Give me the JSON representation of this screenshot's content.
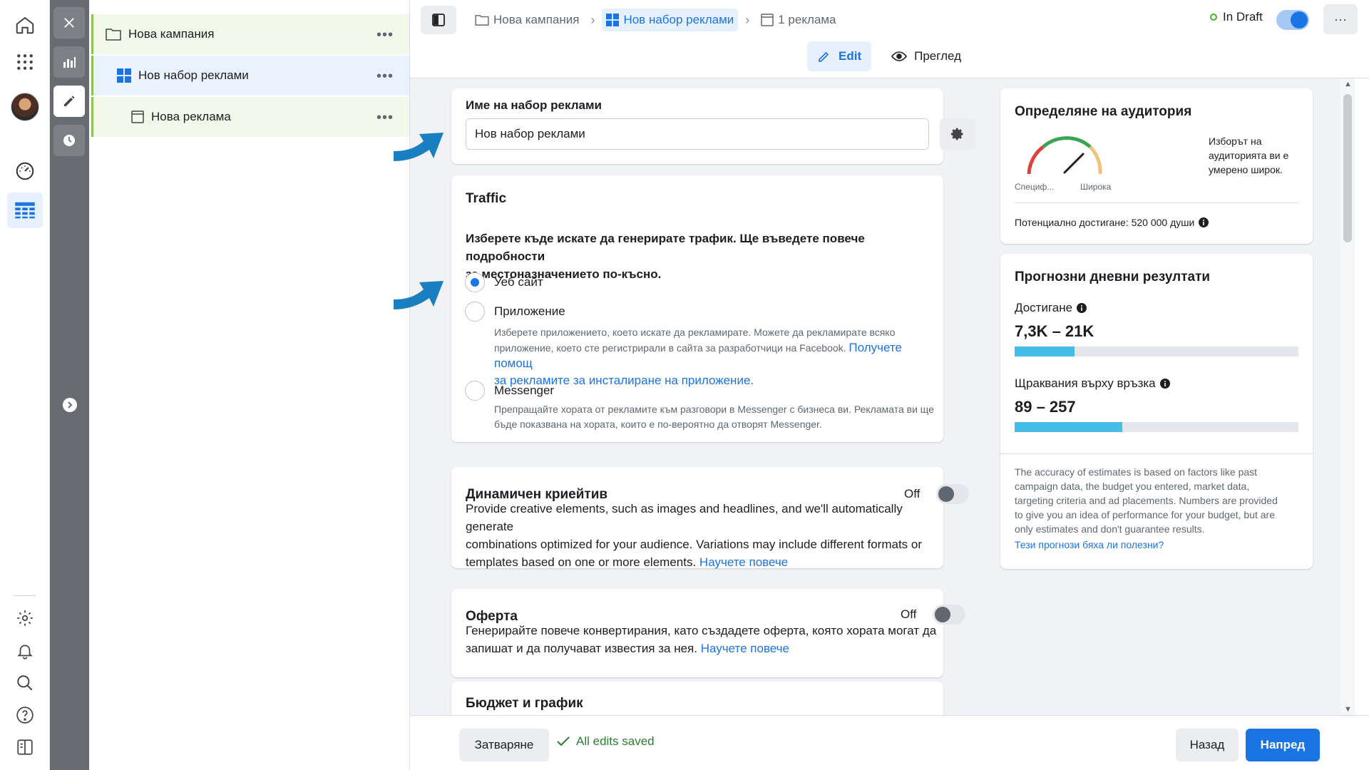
{
  "tree": {
    "campaign": "Нова кампания",
    "adset": "Нов набор реклами",
    "ad": "Нова реклама",
    "more": "•••"
  },
  "topbar": {
    "crumb_campaign": "Нова кампания",
    "crumb_adset": "Нов набор реклами",
    "crumb_ad": "1 реклама",
    "status": "In Draft",
    "more": "···",
    "tab_edit": "Edit",
    "tab_preview": "Преглед"
  },
  "adset_name": {
    "label": "Име на набор реклами",
    "value": "Нов набор реклами"
  },
  "traffic": {
    "title": "Traffic",
    "question_line1": "Изберете къде искате да генерирате трафик. Ще въведете повече подробности",
    "question_line2": "за местоназначението по-късно.",
    "opt_website": "Уеб сайт",
    "opt_app": "Приложение",
    "app_desc_line1": "Изберете приложението, което искате да рекламирате. Можете да рекламирате всяко",
    "app_desc_line2": "приложение, което сте регистрирали в сайта за разработчици на Facebook.",
    "app_link_line1": "Получете помощ",
    "app_link_line2": "за рекламите за инсталиране на приложение",
    "app_link_end": ".",
    "opt_messenger": "Messenger",
    "messenger_desc_line1": "Препращайте хората от рекламите към разговори в Messenger с бизнеса ви. Рекламата ви ще",
    "messenger_desc_line2": "бъде показвана на хората, които е по-вероятно да отворят Messenger."
  },
  "dynamic": {
    "title": "Динамичен криейтив",
    "toggle": "Off",
    "line1": "Provide creative elements, such as images and headlines, and we'll automatically generate",
    "line2": "combinations optimized for your audience. Variations may include different formats or",
    "line3": "templates based on one or more elements.",
    "link": "Научете повече"
  },
  "offer": {
    "title": "Оферта",
    "toggle": "Off",
    "line1": "Генерирайте повече конвертирания, като създадете оферта, която хората могат да",
    "line2": "запишат и да получават известия за нея.",
    "link": "Научете повече"
  },
  "budget": {
    "title": "Бюджет и график"
  },
  "audience": {
    "title": "Определяне на аудитория",
    "gauge_left": "Специф...",
    "gauge_right": "Широка",
    "note_line1": "Изборът на",
    "note_line2": "аудиторията ви е",
    "note_line3": "умерено широк.",
    "reach": "Потенциално достигане: 520 000 души"
  },
  "forecast": {
    "title": "Прогнозни дневни резултати",
    "reach_label": "Достигане",
    "reach_value": "7,3K – 21K",
    "reach_fraction": 0.21,
    "clicks_label": "Щраквания върху връзка",
    "clicks_value": "89 – 257",
    "clicks_fraction": 0.38,
    "note_line1": "The accuracy of estimates is based on factors like past",
    "note_line2": "campaign data, the budget you entered, market data,",
    "note_line3": "targeting criteria and ad placements. Numbers are provided",
    "note_line4": "to give you an idea of performance for your budget, but are",
    "note_line5": "only estimates and don't guarantee results.",
    "feedback": "Тези прогнози бяха ли полезни?"
  },
  "bottom": {
    "close": "Затваряне",
    "saved": "All edits saved",
    "back": "Назад",
    "next": "Напред"
  },
  "colors": {
    "accent": "#1b74e4",
    "annotation_arrow": "#1a7fc1",
    "draft_dot": "#42b72a",
    "progress": "#45bde8"
  }
}
